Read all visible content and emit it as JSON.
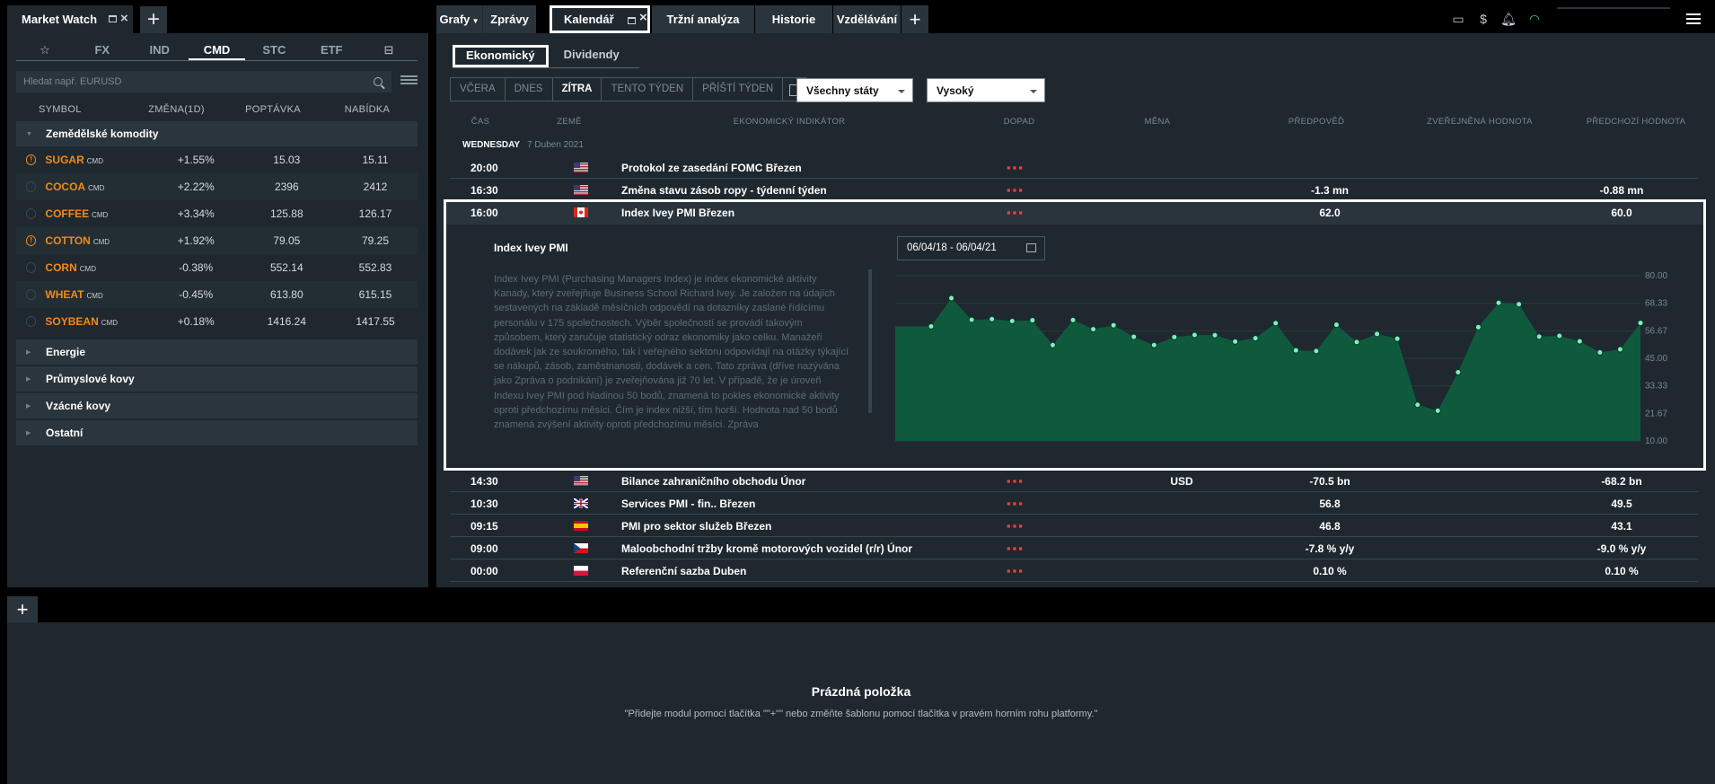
{
  "market_watch": {
    "title": "Market Watch",
    "categories": [
      "FX",
      "IND",
      "CMD",
      "STC",
      "ETF"
    ],
    "search_placeholder": "Hledat např. EURUSD",
    "columns": {
      "symbol": "SYMBOL",
      "change": "ZMĚNA(1D)",
      "bid": "POPTÁVKA",
      "ask": "NABÍDKA"
    },
    "groups": [
      "Zemědělské komodity",
      "Energie",
      "Průmyslové kovy",
      "Vzácné kovy",
      "Ostatní"
    ],
    "rows": [
      {
        "symbol": "SUGAR",
        "tag": "CMD",
        "change": "+1.55%",
        "bid": "15.03",
        "ask": "15.11"
      },
      {
        "symbol": "COCOA",
        "tag": "CMD",
        "change": "+2.22%",
        "bid": "2396",
        "ask": "2412"
      },
      {
        "symbol": "COFFEE",
        "tag": "CMD",
        "change": "+3.34%",
        "bid": "125.88",
        "ask": "126.17"
      },
      {
        "symbol": "COTTON",
        "tag": "CMD",
        "change": "+1.92%",
        "bid": "79.05",
        "ask": "79.25"
      },
      {
        "symbol": "CORN",
        "tag": "CMD",
        "change": "-0.38%",
        "bid": "552.14",
        "ask": "552.83"
      },
      {
        "symbol": "WHEAT",
        "tag": "CMD",
        "change": "-0.45%",
        "bid": "613.80",
        "ask": "615.15"
      },
      {
        "symbol": "SOYBEAN",
        "tag": "CMD",
        "change": "+0.18%",
        "bid": "1416.24",
        "ask": "1417.55"
      }
    ]
  },
  "nav_tabs": [
    "Grafy",
    "Zprávy",
    "Kalendář",
    "Tržní analýza",
    "Historie",
    "Vzdělávání"
  ],
  "calendar": {
    "sub_tabs": [
      "Ekonomický",
      "Dividendy"
    ],
    "day_buttons": [
      "VČERA",
      "DNES",
      "ZÍTRA",
      "TENTO TÝDEN",
      "PŘÍŠTÍ TÝDEN"
    ],
    "country_filter": "Všechny státy",
    "impact_filter": "Vysoký",
    "columns": [
      "ČAS",
      "ZEMĚ",
      "EKONOMICKÝ INDIKÁTOR",
      "DOPAD",
      "MĚNA",
      "PŘEDPOVĚĎ",
      "ZVEŘEJNĚNÁ HODNOTA",
      "PŘEDCHOZÍ HODNOTA"
    ],
    "day_label": "WEDNESDAY",
    "date_label": "7 Duben 2021",
    "impact_marker": "▪▪▪",
    "events": [
      {
        "time": "20:00",
        "flag": "us",
        "indicator": "Protokol ze zasedání FOMC Březen",
        "currency": "",
        "forecast": "",
        "actual": "",
        "previous": ""
      },
      {
        "time": "16:30",
        "flag": "us",
        "indicator": "Změna stavu zásob ropy - týdenní týden",
        "currency": "",
        "forecast": "-1.3 mn",
        "actual": "",
        "previous": "-0.88 mn"
      },
      {
        "time": "16:00",
        "flag": "ca",
        "indicator": "Index Ivey PMI Březen",
        "currency": "",
        "forecast": "62.0",
        "actual": "",
        "previous": "60.0"
      },
      {
        "time": "14:30",
        "flag": "us",
        "indicator": "Bilance zahraničního obchodu Únor",
        "currency": "USD",
        "forecast": "-70.5 bn",
        "actual": "",
        "previous": "-68.2 bn"
      },
      {
        "time": "10:30",
        "flag": "gb",
        "indicator": "Services PMI - fin.. Březen",
        "currency": "",
        "forecast": "56.8",
        "actual": "",
        "previous": "49.5"
      },
      {
        "time": "09:15",
        "flag": "es",
        "indicator": "PMI pro sektor služeb Březen",
        "currency": "",
        "forecast": "46.8",
        "actual": "",
        "previous": "43.1"
      },
      {
        "time": "09:00",
        "flag": "cz",
        "indicator": "Maloobchodní tržby kromě motorových vozidel (r/r) Únor",
        "currency": "",
        "forecast": "-7.8 % y/y",
        "actual": "",
        "previous": "-9.0 % y/y"
      },
      {
        "time": "00:00",
        "flag": "pl",
        "indicator": "Referenční sazba Duben",
        "currency": "",
        "forecast": "0.10 %",
        "actual": "",
        "previous": "0.10 %"
      }
    ],
    "detail": {
      "title": "Index Ivey PMI",
      "date_range": "06/04/18 - 06/04/21",
      "description": "Index Ivey PMI (Purchasing Managers Index) je index ekonomické aktivity Kanady, který zveřejňuje Business School Richard Ivey. Je založen na údajích sestavených na základě měsíčních odpovědí na dotazníky zaslané řídícímu personálu v 175 společnostech. Výběr společností se provádí takovým způsobem, který zaručuje statistický odraz ekonomiky jako celku. Manažeři dodávek jak ze soukromého, tak i veřejného sektoru odpovídají na otázky týkající se nákupů, zásob, zaměstnanosti, dodávek a cen. Tato zpráva (dříve nazývána jako Zpráva o podnikání) je zveřejňována již 70 let. V případě, že je úroveň Indexu Ivey PMI pod hladinou 50 bodů, znamená to pokles ekonomické aktivity oproti předchozímu měsíci. Čím je index nižší, tím horší. Hodnota nad 50 bodů znamená zvýšení aktivity oproti předchozímu měsíci. Zpráva"
    }
  },
  "chart_data": {
    "type": "area",
    "title": "",
    "y_ticks": [
      "80.00",
      "68.33",
      "56.67",
      "45.00",
      "33.33",
      "21.67",
      "10.00"
    ],
    "ylim": [
      10,
      80
    ],
    "values": [
      58.5,
      70.5,
      61.3,
      61.6,
      60.8,
      61.1,
      50.6,
      61.2,
      57.3,
      59.0,
      54.1,
      50.6,
      54.0,
      54.9,
      54.8,
      52.1,
      53.5,
      59.9,
      48.4,
      48.1,
      59.2,
      51.9,
      55.3,
      53.3,
      25.3,
      22.8,
      39.1,
      58.2,
      68.5,
      67.9,
      54.2,
      54.5,
      52.2,
      47.5,
      48.8,
      60.0
    ],
    "fill": "#0f5a3c",
    "point_color": "#7cf0c0"
  },
  "bottom": {
    "empty_title": "Prázdná položka",
    "empty_sub": "\"Přidejte modul pomocí tlačítka \"\"+\"\" nebo změňte šablonu pomocí tlačítka v pravém horním rohu platformy.\""
  }
}
